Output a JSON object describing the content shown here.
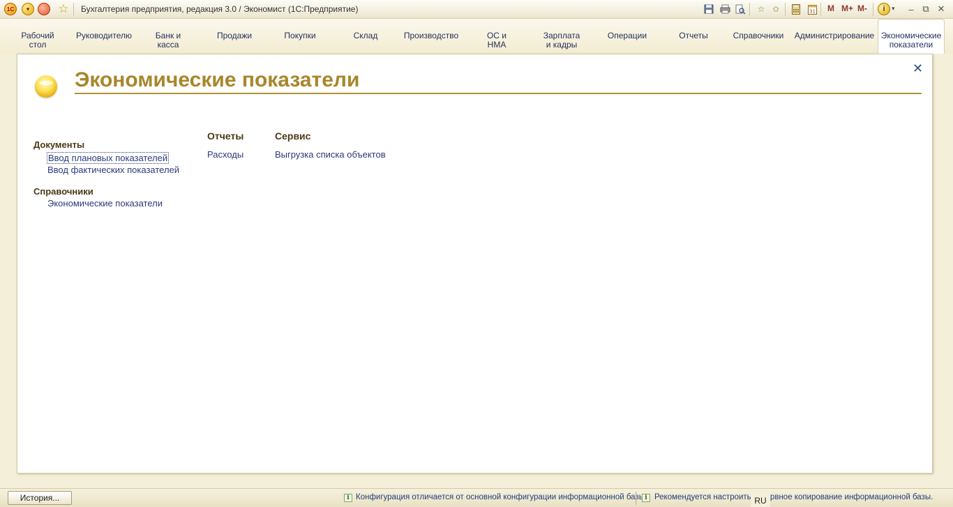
{
  "window": {
    "title": "Бухгалтерия предприятия, редакция 3.0 / Экономист  (1С:Предприятие)",
    "icons_left": [
      "1c-logo-icon",
      "main-menu-icon",
      "record-icon",
      "favorites-star-icon"
    ],
    "icons_right": [
      "save-icon",
      "print-icon",
      "preview-icon",
      "add-favorites-icon",
      "favorites-icon",
      "calculator-icon",
      "calendar-icon"
    ],
    "memory_buttons": [
      "M",
      "M+",
      "M-"
    ],
    "info_label": "i",
    "minimize": "–",
    "restore": "⧉",
    "close": "✕"
  },
  "sections": [
    {
      "label": "Рабочий\nстол"
    },
    {
      "label": "Руководителю"
    },
    {
      "label": "Банк и\nкасса"
    },
    {
      "label": "Продажи"
    },
    {
      "label": "Покупки"
    },
    {
      "label": "Склад"
    },
    {
      "label": "Производство"
    },
    {
      "label": "ОС и\nНМА"
    },
    {
      "label": "Зарплата\nи кадры"
    },
    {
      "label": "Операции"
    },
    {
      "label": "Отчеты"
    },
    {
      "label": "Справочники"
    },
    {
      "label": "Администрирование"
    },
    {
      "label": "Экономические\nпоказатели",
      "active": true
    }
  ],
  "page": {
    "title": "Экономические показатели",
    "close": "✕",
    "documents": {
      "heading": "Документы",
      "links": [
        "Ввод плановых показателей",
        "Ввод фактических показателей"
      ]
    },
    "catalogs": {
      "heading": "Справочники",
      "links": [
        "Экономические показатели"
      ]
    },
    "reports": {
      "heading": "Отчеты",
      "links": [
        "Расходы"
      ]
    },
    "service": {
      "heading": "Сервис",
      "links": [
        "Выгрузка списка объектов"
      ]
    }
  },
  "statusbar": {
    "history_button": "История...",
    "info_icon": "i",
    "message1": "Конфигурация отличается от основной конфигурации информационной базы.",
    "message2": "Рекомендуется настроить резервное копирование информационной базы.",
    "language": "RU"
  },
  "colors": {
    "accent_gold": "#a8862a",
    "link_blue": "#2c3a78",
    "background": "#f4efd9"
  }
}
